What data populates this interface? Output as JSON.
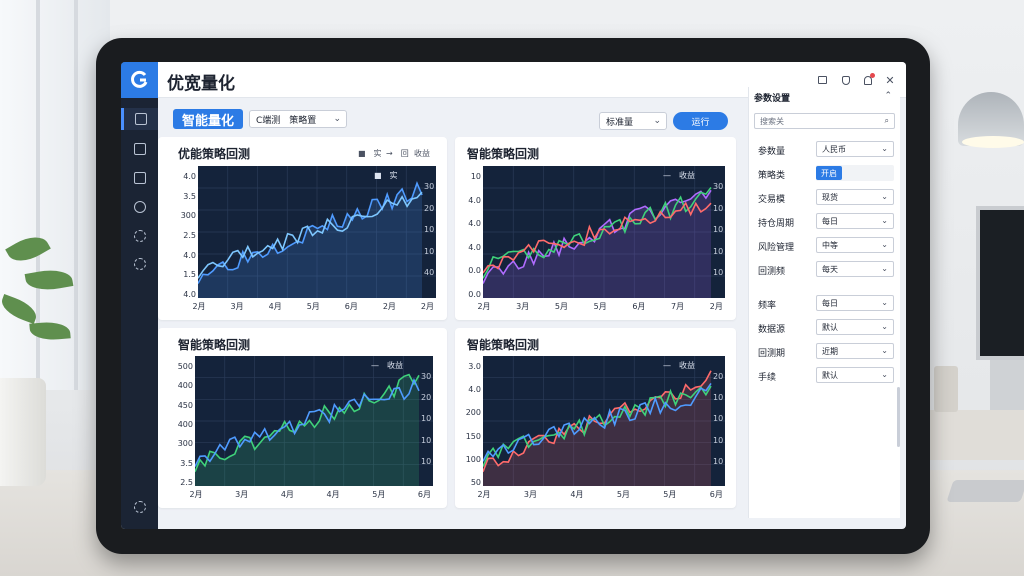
{
  "app": {
    "title": "优宽量化"
  },
  "sidebar": {
    "items": [
      {
        "name": "home-icon"
      },
      {
        "name": "calendar-icon"
      },
      {
        "name": "document-icon"
      },
      {
        "name": "user-icon"
      },
      {
        "name": "settings-icon"
      },
      {
        "name": "gear-icon"
      }
    ],
    "footer_icon": "settings-icon"
  },
  "toolbar": {
    "strategy_button": "智能量化",
    "select1": "C端测　策略置",
    "select2": "标准量",
    "run_button": "运行"
  },
  "panels": [
    {
      "title": "优能策略回测",
      "legend": [
        "■　实",
        "→　回",
        "收益"
      ],
      "right_label": "收益",
      "yticks": [
        "4.0",
        "3.5",
        "300",
        "2.5",
        "4.0",
        "1.5",
        "4.0"
      ],
      "xticks": [
        "2月",
        "3月",
        "4月",
        "5月",
        "6月",
        "2月",
        "2月"
      ],
      "rticks": [
        "30",
        "20",
        "10",
        "10",
        "40"
      ],
      "colors": {
        "a": "#4f9bff",
        "b": "#7ec7ff"
      }
    },
    {
      "title": "智能策略回测",
      "legend": [
        "—　收益"
      ],
      "yticks": [
        "10",
        "4.0",
        "4.0",
        "4.0",
        "0.0",
        "0.0"
      ],
      "xticks": [
        "2月",
        "3月",
        "5月",
        "5月",
        "6月",
        "7月",
        "2月"
      ],
      "rticks": [
        "30",
        "10",
        "10",
        "10",
        "10"
      ],
      "colors": {
        "a": "#b06cff",
        "b": "#3fd17a",
        "c": "#ff6b6b"
      }
    },
    {
      "title": "智能策略回测",
      "legend": [
        "—　收益"
      ],
      "yticks": [
        "500",
        "400",
        "450",
        "400",
        "300",
        "3.5",
        "2.5"
      ],
      "xticks": [
        "2月",
        "3月",
        "4月",
        "4月",
        "5月",
        "6月"
      ],
      "rticks": [
        "30",
        "20",
        "10",
        "10",
        "10"
      ],
      "colors": {
        "a": "#3fd17a",
        "b": "#4f9bff"
      }
    },
    {
      "title": "智能策略回测",
      "legend": [
        "—　收益"
      ],
      "yticks": [
        "3.0",
        "4.0",
        "200",
        "150",
        "100",
        "50"
      ],
      "xticks": [
        "2月",
        "3月",
        "4月",
        "5月",
        "5月",
        "6月"
      ],
      "rticks": [
        "20",
        "10",
        "10",
        "10",
        "10"
      ],
      "colors": {
        "a": "#ff6b6b",
        "b": "#3fd17a",
        "c": "#4f9bff"
      }
    }
  ],
  "params": {
    "header": "参数设置",
    "search_placeholder": "搜索关",
    "rows": [
      {
        "label": "参数量",
        "value": "人民币"
      },
      {
        "label": "策略类",
        "value": "开启",
        "toggle": true
      },
      {
        "label": "交易模",
        "value": "现货"
      },
      {
        "label": "持仓周期",
        "value": "每日"
      },
      {
        "label": "风险管理",
        "value": "中等"
      },
      {
        "label": "回测频",
        "value": "每天"
      },
      {
        "label": "频率",
        "value": "每日"
      },
      {
        "label": "数据源",
        "value": "默认"
      },
      {
        "label": "回测期",
        "value": "近期"
      },
      {
        "label": "手续",
        "value": "默认"
      }
    ]
  }
}
